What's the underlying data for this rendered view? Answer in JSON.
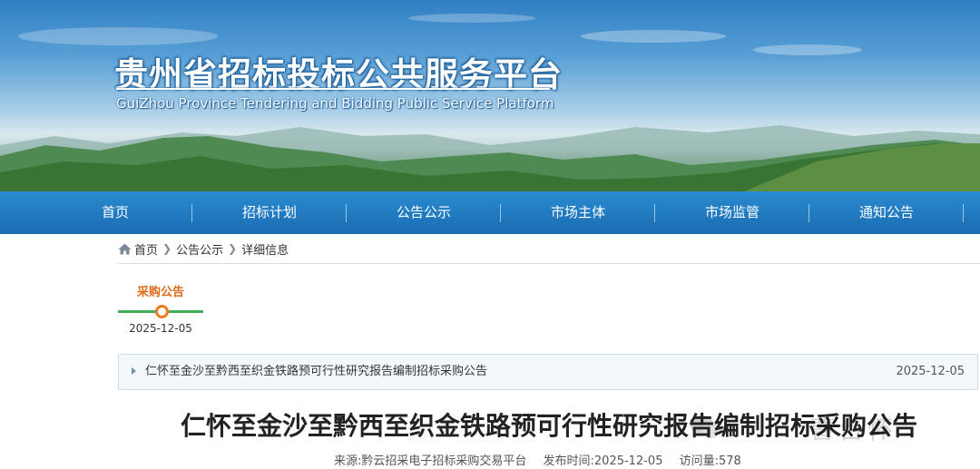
{
  "header": {
    "title": "贵州省招标投标公共服务平台",
    "subtitle": "GuiZhou Province Tendering and Bidding Public Service Platform"
  },
  "nav": {
    "items": [
      {
        "label": "首页"
      },
      {
        "label": "招标计划"
      },
      {
        "label": "公告公示"
      },
      {
        "label": "市场主体"
      },
      {
        "label": "市场监管"
      },
      {
        "label": "通知公告"
      }
    ]
  },
  "breadcrumb": {
    "home": "首页",
    "level1": "公告公示",
    "current": "详细信息"
  },
  "timeline": {
    "label": "采购公告",
    "date": "2025-12-05"
  },
  "announcement": {
    "title": "仁怀至金沙至黔西至织金铁路预可行性研究报告编制招标采购公告",
    "date": "2025-12-05"
  },
  "article": {
    "title": "仁怀至金沙至黔西至织金铁路预可行性研究报告编制招标采购公告",
    "source": "来源:黔云招采电子招标采购交易平台",
    "published": "发布时间:2025-12-05",
    "views": "访问量:578"
  },
  "watermark": {
    "text": "曹台怀"
  },
  "colors": {
    "nav_bg": "#1a6cb2",
    "timeline_accent": "#e06a17",
    "timeline_line": "#3fae57"
  }
}
